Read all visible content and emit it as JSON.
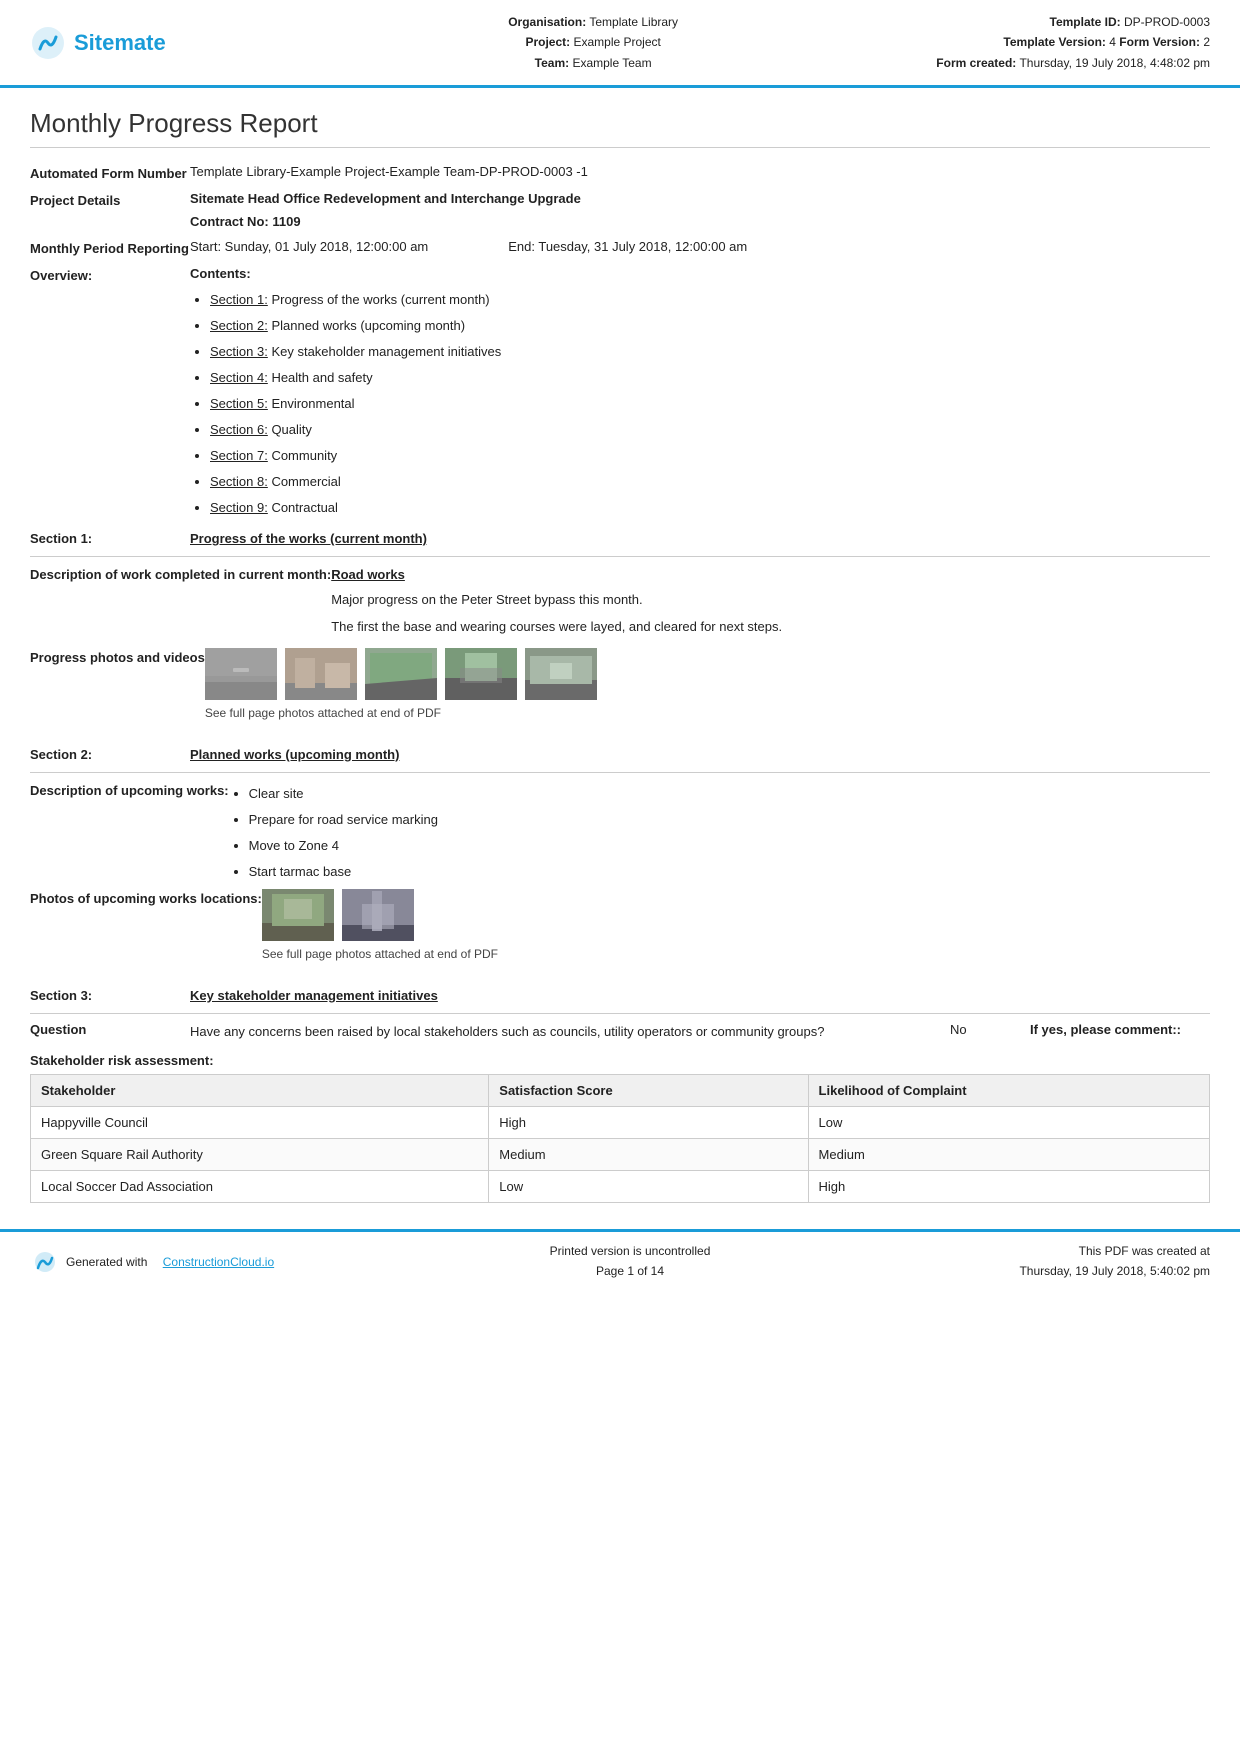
{
  "header": {
    "logo_text": "Sitemate",
    "org_label": "Organisation:",
    "org_value": "Template Library",
    "project_label": "Project:",
    "project_value": "Example Project",
    "team_label": "Team:",
    "team_value": "Example Team",
    "template_id_label": "Template ID:",
    "template_id_value": "DP-PROD-0003",
    "template_version_label": "Template Version:",
    "template_version_value": "4",
    "form_version_label": "Form Version:",
    "form_version_value": "2",
    "form_created_label": "Form created:",
    "form_created_value": "Thursday, 19 July 2018, 4:48:02 pm"
  },
  "page_title": "Monthly Progress Report",
  "form_number_label": "Automated Form Number",
  "form_number_value": "Template Library-Example Project-Example Team-DP-PROD-0003   -1",
  "project_details_label": "Project Details",
  "project_details_value": "Sitemate Head Office Redevelopment and Interchange Upgrade",
  "contract_label": "Contract No:",
  "contract_value": "1109",
  "period_label": "Monthly Period Reporting",
  "period_start": "Start: Sunday, 01 July 2018, 12:00:00 am",
  "period_end": "End: Tuesday, 31 July 2018, 12:00:00 am",
  "overview_label": "Overview:",
  "contents_title": "Contents:",
  "contents_items": [
    {
      "link": "Section 1:",
      "text": " Progress of the works (current month)"
    },
    {
      "link": "Section 2:",
      "text": " Planned works (upcoming month)"
    },
    {
      "link": "Section 3:",
      "text": " Key stakeholder management initiatives"
    },
    {
      "link": "Section 4:",
      "text": " Health and safety"
    },
    {
      "link": "Section 5:",
      "text": " Environmental"
    },
    {
      "link": "Section 6:",
      "text": " Quality"
    },
    {
      "link": "Section 7:",
      "text": " Community"
    },
    {
      "link": "Section 8:",
      "text": " Commercial"
    },
    {
      "link": "Section 9:",
      "text": " Contractual"
    }
  ],
  "section1_label": "Section 1:",
  "section1_title": "Progress of the works (current month)",
  "desc_work_label": "Description of work completed in current month:",
  "road_works_title": "Road works",
  "road_works_text1": "Major progress on the Peter Street bypass this month.",
  "road_works_text2": "The first the base and wearing courses were layed, and cleared for next steps.",
  "progress_photos_label": "Progress photos and videos",
  "photos_caption": "See full page photos attached at end of PDF",
  "section2_label": "Section 2:",
  "section2_title": "Planned works (upcoming month)",
  "desc_upcoming_label": "Description of upcoming works:",
  "upcoming_works": [
    "Clear site",
    "Prepare for road service marking",
    "Move to Zone 4",
    "Start tarmac base"
  ],
  "photos_upcoming_label": "Photos of upcoming works locations:",
  "photos_upcoming_caption": "See full page photos attached at end of PDF",
  "section3_label": "Section 3:",
  "section3_title": "Key stakeholder management initiatives",
  "question_label": "Question",
  "question_text": "Have any concerns been raised by local stakeholders such as councils, utility operators or community groups?",
  "question_no": "No",
  "question_ifyes": "If yes, please comment::",
  "stakeholder_title": "Stakeholder risk assessment:",
  "table_headers": [
    "Stakeholder",
    "Satisfaction Score",
    "Likelihood of Complaint"
  ],
  "table_rows": [
    [
      "Happyville Council",
      "High",
      "Low"
    ],
    [
      "Green Square Rail Authority",
      "Medium",
      "Medium"
    ],
    [
      "Local Soccer Dad Association",
      "Low",
      "High"
    ]
  ],
  "footer_generated": "Generated with",
  "footer_link": "ConstructionCloud.io",
  "footer_uncontrolled": "Printed version is uncontrolled",
  "footer_page": "Page 1 of 14",
  "footer_pdf_created": "This PDF was created at",
  "footer_pdf_date": "Thursday, 19 July 2018, 5:40:02 pm"
}
